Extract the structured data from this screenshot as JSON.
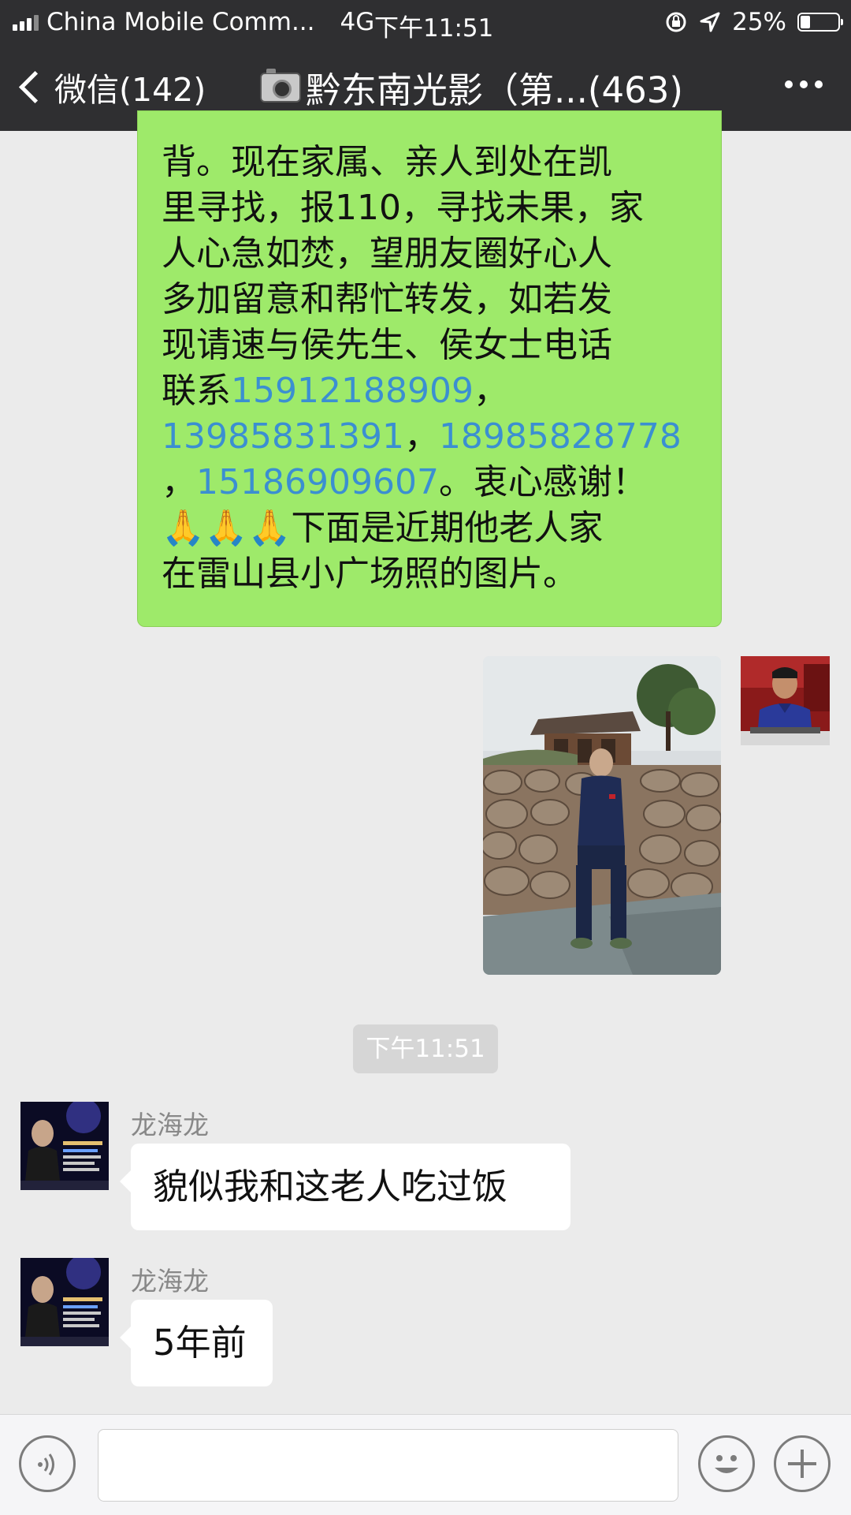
{
  "status_bar": {
    "carrier": "China Mobile Comm...",
    "network": "4G",
    "time": "下午11:51",
    "battery": "25%",
    "battery_level": 0.25
  },
  "nav": {
    "back_label": "微信(142)",
    "title": "黔东南光影（第...(463)"
  },
  "outgoing_text": {
    "lines": [
      [
        {
          "t": "背。现在家属、亲人到处在凯",
          "phone": false
        }
      ],
      [
        {
          "t": "里寻找，报110，寻找未果，家",
          "phone": false
        }
      ],
      [
        {
          "t": "人心急如焚，望朋友圈好心人",
          "phone": false
        }
      ],
      [
        {
          "t": "多加留意和帮忙转发，如若发",
          "phone": false
        }
      ],
      [
        {
          "t": "现请速与侯先生、侯女士电话",
          "phone": false
        }
      ],
      [
        {
          "t": "联系",
          "phone": false
        },
        {
          "t": "15912188909",
          "phone": true
        },
        {
          "t": "，",
          "phone": false
        }
      ],
      [
        {
          "t": "13985831391",
          "phone": true
        },
        {
          "t": "，",
          "phone": false
        },
        {
          "t": "18985828778",
          "phone": true
        }
      ],
      [
        {
          "t": "，",
          "phone": false
        },
        {
          "t": "15186909607",
          "phone": true
        },
        {
          "t": "。衷心感谢！",
          "phone": false
        }
      ],
      [
        {
          "t": "🙏🙏🙏下面是近期他老人家",
          "phone": false
        }
      ],
      [
        {
          "t": "在雷山县小广场照的图片。",
          "phone": false
        }
      ]
    ]
  },
  "timestamp": "下午11:51",
  "incoming": [
    {
      "sender": "龙海龙",
      "text": "貌似我和这老人吃过饭"
    },
    {
      "sender": "龙海龙",
      "text": "5年前"
    }
  ],
  "input": {
    "placeholder": ""
  },
  "colors": {
    "header_bg": "#2f2f31",
    "chat_bg": "#ebebeb",
    "outgoing_bubble": "#9eea6a",
    "phone_link": "#3b8fd1",
    "incoming_bubble": "#ffffff"
  },
  "icons": {
    "back": "chevron-left-icon",
    "more": "more-dots-icon",
    "voice": "voice-icon",
    "emoji": "emoji-icon",
    "plus": "plus-icon"
  }
}
